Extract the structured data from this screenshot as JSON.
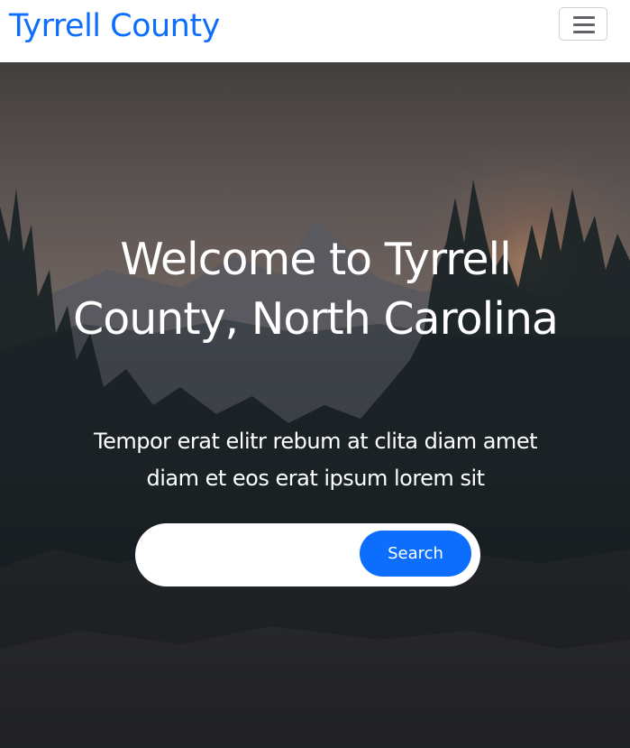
{
  "navbar": {
    "brand": "Tyrrell County",
    "toggler_icon": "hamburger-menu-icon"
  },
  "hero": {
    "title": "Welcome to Tyrrell County, North Carolina",
    "subtitle": "Tempor erat elitr rebum at clita diam amet diam et eos erat ipsum lorem sit",
    "search": {
      "value": "",
      "placeholder": "",
      "button_label": "Search"
    }
  },
  "colors": {
    "accent": "#0d6efd",
    "navbar_bg": "#ffffff",
    "hero_text": "#ffffff"
  }
}
